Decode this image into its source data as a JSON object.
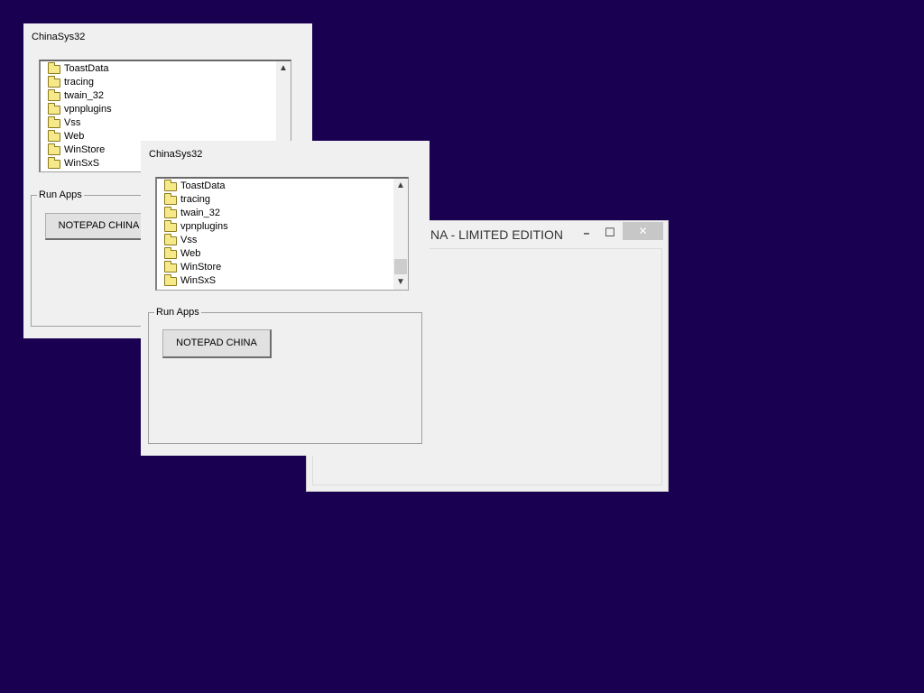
{
  "back_window": {
    "title": "ChinaSys32",
    "folders": [
      "ToastData",
      "tracing",
      "twain_32",
      "vpnplugins",
      "Vss",
      "Web",
      "WinStore",
      "WinSxS"
    ],
    "group_label": "Run Apps",
    "button_label": "NOTEPAD CHINA"
  },
  "front_window": {
    "title": "ChinaSys32",
    "folders": [
      "ToastData",
      "tracing",
      "twain_32",
      "vpnplugins",
      "Vss",
      "Web",
      "WinStore",
      "WinSxS"
    ],
    "group_label": "Run Apps",
    "button_label": "NOTEPAD CHINA"
  },
  "notepad_window": {
    "title_visible": "NA - LIMITED EDITION",
    "minimize_glyph": "–",
    "maximize_glyph": "☐",
    "close_glyph": "✕"
  },
  "colors": {
    "desktop": "#1a0050",
    "window": "#f0f0f0",
    "close_button": "#c7c7c7"
  }
}
